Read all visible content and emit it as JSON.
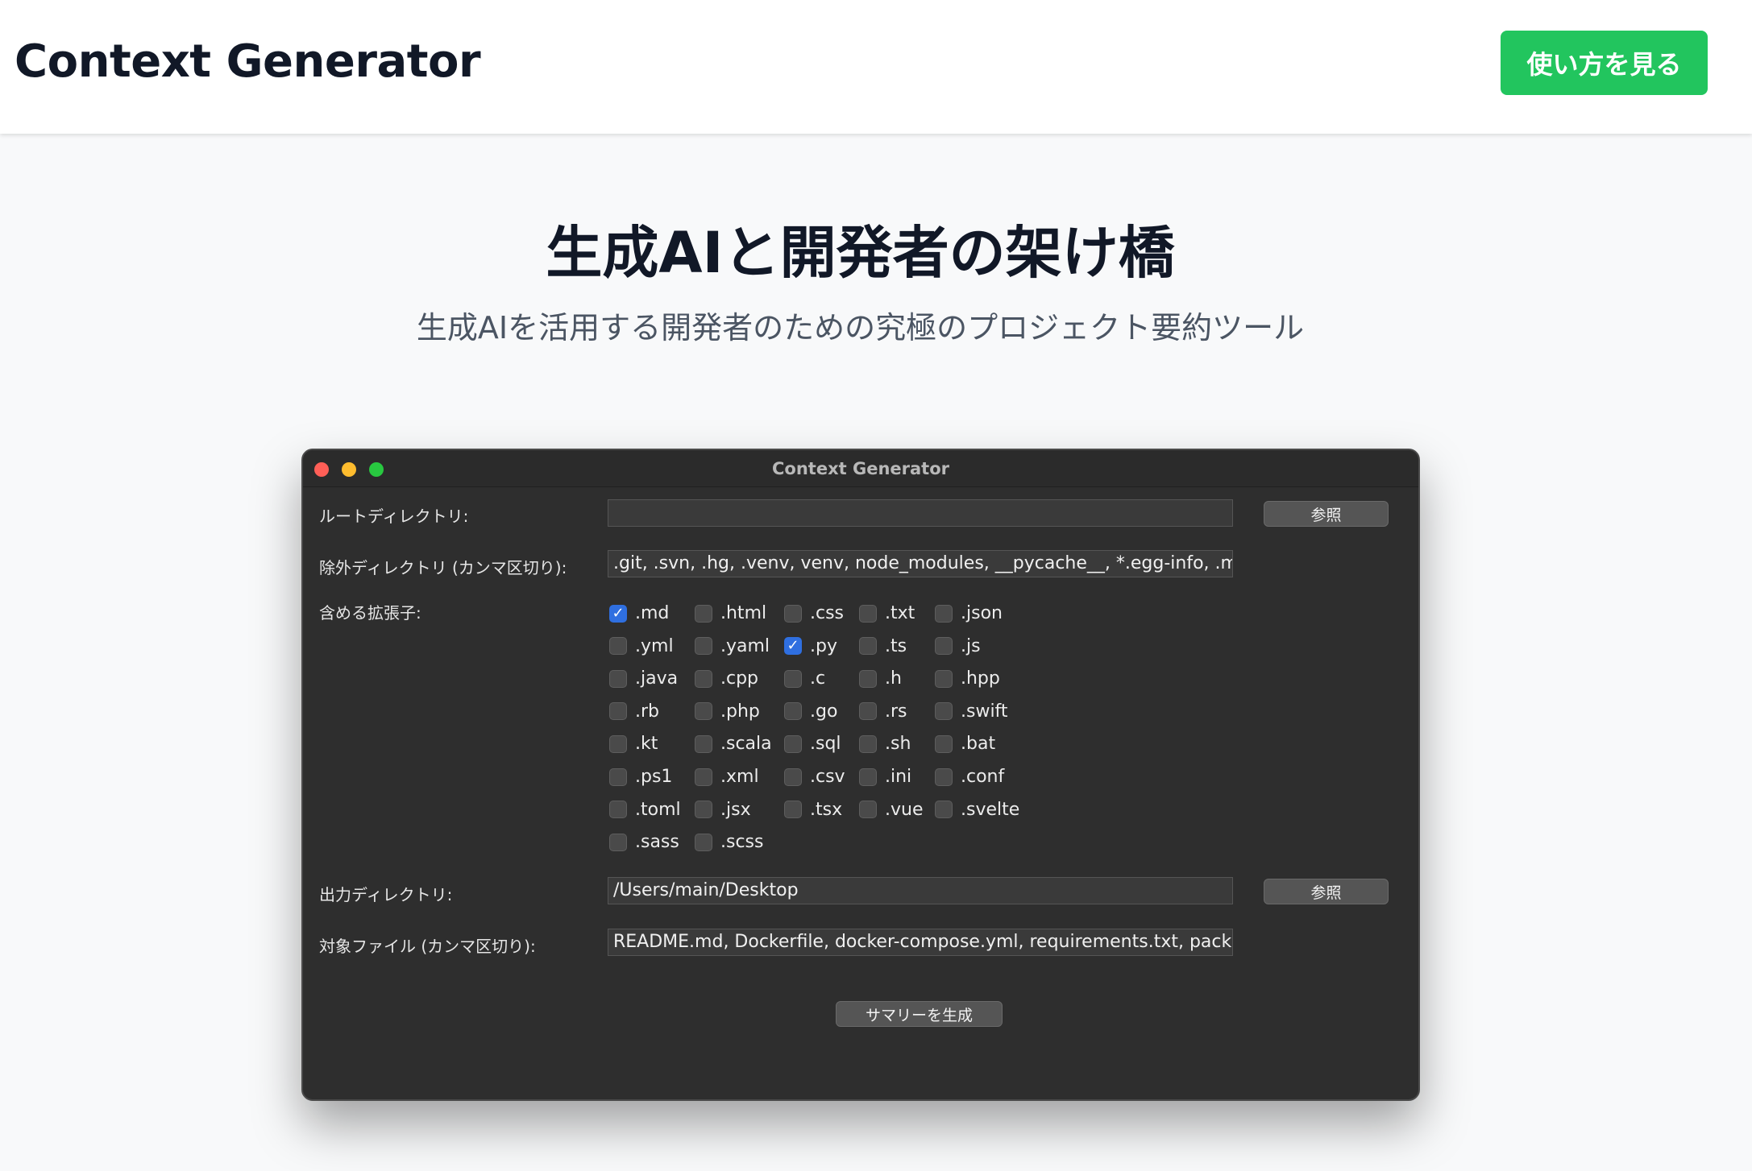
{
  "header": {
    "brand": "Context Generator",
    "cta_label": "使い方を見る"
  },
  "hero": {
    "title": "生成AIと開発者の架け橋",
    "subtitle": "生成AIを活用する開発者のための究極のプロジェクト要約ツール"
  },
  "app": {
    "window_title": "Context Generator",
    "root_dir_label": "ルートディレクトリ:",
    "root_dir_value": "",
    "browse_label": "参照",
    "exclude_label": "除外ディレクトリ (カンマ区切り):",
    "exclude_value": ".git, .svn, .hg, .venv, venv, node_modules, __pycache__, *.egg-info, .mypy",
    "ext_label": "含める拡張子:",
    "extensions": [
      [
        ".md",
        ".html",
        ".css",
        ".txt",
        ".json"
      ],
      [
        ".yml",
        ".yaml",
        ".py",
        ".ts",
        ".js"
      ],
      [
        ".java",
        ".cpp",
        ".c",
        ".h",
        ".hpp"
      ],
      [
        ".rb",
        ".php",
        ".go",
        ".rs",
        ".swift"
      ],
      [
        ".kt",
        ".scala",
        ".sql",
        ".sh",
        ".bat"
      ],
      [
        ".ps1",
        ".xml",
        ".csv",
        ".ini",
        ".conf"
      ],
      [
        ".toml",
        ".jsx",
        ".tsx",
        ".vue",
        ".svelte"
      ],
      [
        ".sass",
        ".scss"
      ]
    ],
    "checked": [
      ".md",
      ".py"
    ],
    "output_dir_label": "出力ディレクトリ:",
    "output_dir_value": "/Users/main/Desktop",
    "target_files_label": "対象ファイル (カンマ区切り):",
    "target_files_value": "README.md, Dockerfile, docker-compose.yml, requirements.txt, package.",
    "generate_label": "サマリーを生成"
  }
}
